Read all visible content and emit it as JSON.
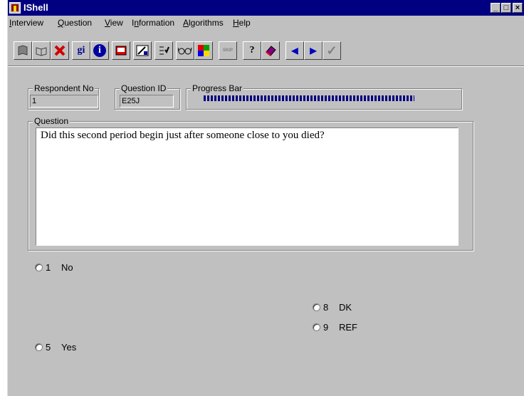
{
  "window": {
    "title": "IShell",
    "min_label": "_",
    "max_label": "□",
    "close_label": "×"
  },
  "menu": [
    {
      "label": "Interview",
      "accel": "I"
    },
    {
      "label": "Question",
      "accel": "Q"
    },
    {
      "label": "View",
      "accel": "V"
    },
    {
      "label": "Information",
      "accel": "n"
    },
    {
      "label": "Algorithms",
      "accel": "A"
    },
    {
      "label": "Help",
      "accel": "H"
    }
  ],
  "toolbar": {
    "gi_label": "gi",
    "info_label": "i",
    "question_label": "?",
    "skip_label": "SKIP",
    "prev_label": "◀",
    "next_label": "▶",
    "check_label": "✓",
    "icons": [
      "book-icon",
      "open-book-icon",
      "delete-icon",
      "gi-icon",
      "info-icon",
      "notepad-icon",
      "edit-icon",
      "checklist-icon",
      "glasses-icon",
      "color-palette-icon",
      "skip-icon",
      "help-icon",
      "eraser-icon",
      "previous-icon",
      "next-icon",
      "checkmark-icon"
    ]
  },
  "respondent": {
    "label": "Respondent No",
    "value": "1"
  },
  "question_id": {
    "label": "Question ID",
    "value": "E25J"
  },
  "progress": {
    "label": "Progress Bar",
    "fraction": 0.8
  },
  "question": {
    "label": "Question",
    "text": "Did this second period begin just after someone close to you died?"
  },
  "options": [
    {
      "code": "1",
      "label": "No"
    },
    {
      "code": "8",
      "label": "DK"
    },
    {
      "code": "9",
      "label": "REF"
    },
    {
      "code": "5",
      "label": "Yes"
    }
  ],
  "colors": {
    "titlebar": "#000080",
    "face": "#c0c0c0",
    "progress": "#000080"
  }
}
